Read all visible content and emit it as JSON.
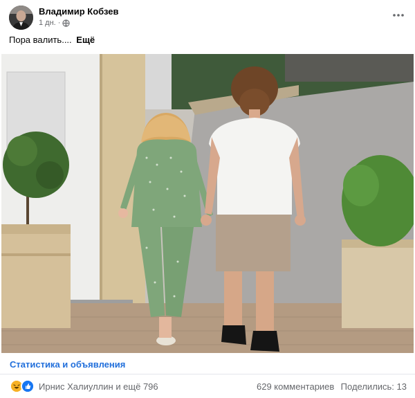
{
  "post": {
    "author": "Владимир Кобзев",
    "time": "1 дн.",
    "separator": "·",
    "text": "Пора валить....",
    "see_more": "Ещё"
  },
  "insights": {
    "label": "Статистика и объявления"
  },
  "engagement": {
    "reactors": "Ирнис Халиуллин и ещё 796",
    "comments": "629 комментариев",
    "shares": "Поделились: 13"
  },
  "icons": {
    "privacy": "globe-icon",
    "menu": "more-horizontal-icon",
    "reactions": [
      "haha-icon",
      "like-icon"
    ]
  },
  "colors": {
    "link": "#216fdb",
    "secondary_text": "#65676b",
    "like_blue": "#1877f2",
    "haha_yellow": "#f7b125"
  }
}
